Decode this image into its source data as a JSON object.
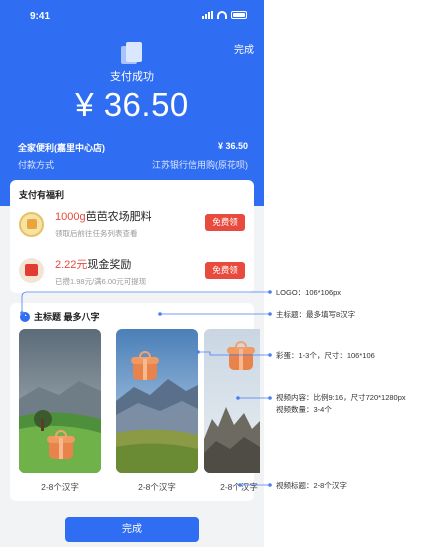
{
  "status_bar": {
    "time": "9:41"
  },
  "header": {
    "done_label": "完成",
    "status_text": "支付成功",
    "amount": "¥ 36.50"
  },
  "payment": {
    "merchant": "全家便利(嘉里中心店)",
    "merchant_amount": "¥ 36.50",
    "method_label": "付款方式",
    "method_value": "江苏银行信用购(原花呗)"
  },
  "benefits": {
    "title": "支付有福利",
    "items": [
      {
        "highlight": "1000g",
        "name": "芭芭农场肥料",
        "sub": "领取后前往任务列表查看",
        "button": "免费领",
        "icon": "fertilizer-icon"
      },
      {
        "highlight": "2.22元",
        "name": "现金奖励",
        "sub": "已攒1.98元/满6.00元可提现",
        "button": "免费领",
        "icon": "red-packet-icon"
      }
    ]
  },
  "videos": {
    "title": "主标题 最多八字",
    "captions": [
      "2-8个汉字",
      "2-8个汉字",
      "2-8个汉字"
    ]
  },
  "footer": {
    "done_button": "完成"
  },
  "annotations": {
    "logo": "LOGO：106*106px",
    "main_title": "主标题：最多填写8汉字",
    "easter_egg": "彩蛋：1-3个，尺寸：106*106",
    "video_content_1": "视频内容：比例9:16，尺寸720*1280px",
    "video_content_2": "视频数量：3-4个",
    "video_title": "视频标题：2-8个汉字"
  },
  "colors": {
    "brand_blue": "#2f6df2",
    "accent_red": "#e84a3d",
    "annotation_line": "#4a7ef5"
  }
}
